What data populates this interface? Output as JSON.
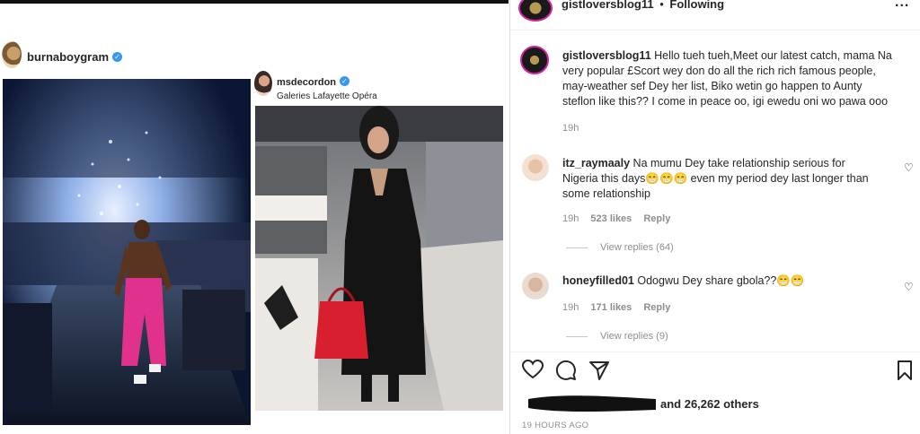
{
  "left": {
    "post1": {
      "username": "burnaboygram",
      "verified": true
    },
    "post2": {
      "username": "msdecordon",
      "verified": true,
      "location": "Galeries Lafayette Opéra"
    }
  },
  "header": {
    "username": "gistloversblog11",
    "separator": "•",
    "follow_status": "Following",
    "more": "..."
  },
  "caption": {
    "username": "gistloversblog11",
    "lines": [
      "Hello tueh tueh,Meet our latest catch, mama Na",
      "very popular £Scort wey don do all the rich rich famous people,",
      "may-weather sef Dey her list, Biko wetin go happen to Aunty",
      "steflon like this?? I come in peace oo, igi ewedu oni wo pawa ooo"
    ],
    "time": "19h"
  },
  "comments": [
    {
      "username": "itz_raymaaly",
      "lines": [
        "Na mumu Dey take relationship serious for",
        "Nigeria this days😁😁😁 even my period dey last longer than",
        "some relationship"
      ],
      "time": "19h",
      "likes": "523 likes",
      "reply": "Reply",
      "view_replies": "View replies (64)"
    },
    {
      "username": "honeyfilled01",
      "lines": [
        "Odogwu Dey share gbola??😁😁"
      ],
      "time": "19h",
      "likes": "171 likes",
      "reply": "Reply",
      "view_replies": "View replies (9)"
    }
  ],
  "likes_text": "and 26,262 others",
  "timestamp": "19 HOURS AGO",
  "colors": {
    "verified": "#3897f0",
    "muted": "#8e8e8e",
    "text": "#262626"
  },
  "icons": [
    "heart-icon",
    "comment-icon",
    "share-icon",
    "bookmark-icon",
    "more-icon"
  ]
}
